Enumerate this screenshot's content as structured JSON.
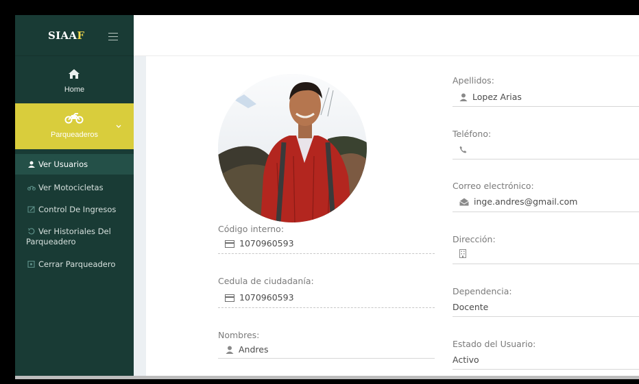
{
  "app": {
    "brand_main": "SIAA",
    "brand_accent": "F"
  },
  "colors": {
    "sidebar": "#193b35",
    "accent_yellow": "#d9cd3c",
    "active_item": "#245048"
  },
  "sidebar": {
    "home_label": "Home",
    "group_label": "Parqueaderos",
    "items": [
      {
        "label": "Ver Usuarios",
        "icon": "user-icon",
        "active": true
      },
      {
        "label": "Ver Motocicletas",
        "icon": "motorcycle-icon"
      },
      {
        "label": "Control De Ingresos",
        "icon": "edit-icon"
      },
      {
        "label_line1": "Ver Historiales Del",
        "label_line2": "Parqueadero",
        "icon": "history-icon"
      },
      {
        "label": "Cerrar Parqueadero",
        "icon": "close-square-icon"
      }
    ]
  },
  "profile": {
    "codigo_label": "Código interno:",
    "codigo_value": "1070960593",
    "cedula_label": "Cedula de ciudadanía:",
    "cedula_value": "1070960593",
    "nombres_label": "Nombres:",
    "nombres_value": "Andres",
    "apellidos_label": "Apellidos:",
    "apellidos_value": "Lopez Arias",
    "telefono_label": "Teléfono:",
    "telefono_value": "",
    "correo_label": "Correo electrónico:",
    "correo_value": "inge.andres@gmail.com",
    "direccion_label": "Dirección:",
    "direccion_value": "",
    "dependencia_label": "Dependencia:",
    "dependencia_value": "Docente",
    "estado_label": "Estado del Usuario:",
    "estado_value": "Activo"
  }
}
